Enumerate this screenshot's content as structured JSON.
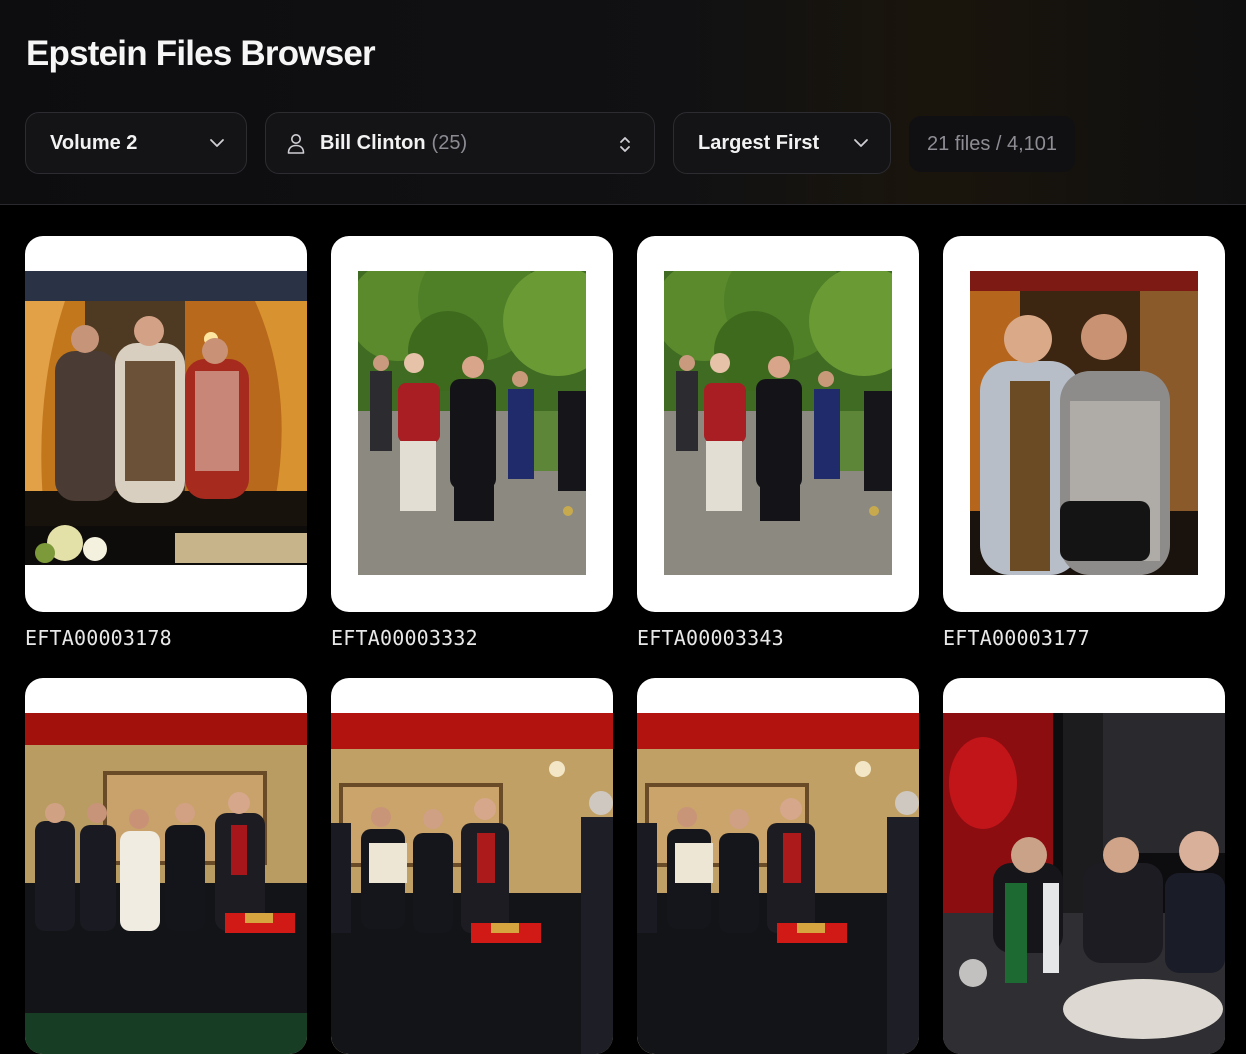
{
  "app": {
    "title": "Epstein Files Browser"
  },
  "filters": {
    "volume": {
      "label": "Volume 2"
    },
    "person": {
      "name": "Bill Clinton",
      "count": "(25)"
    },
    "sort": {
      "label": "Largest First"
    },
    "stats": "21 files / 4,101"
  },
  "files": [
    {
      "id": "EFTA00003178",
      "scene": "party-curtains"
    },
    {
      "id": "EFTA00003332",
      "scene": "park-walk"
    },
    {
      "id": "EFTA00003343",
      "scene": "park-walk"
    },
    {
      "id": "EFTA00003177",
      "scene": "party-two"
    },
    {
      "id": "",
      "scene": "meeting-room"
    },
    {
      "id": "",
      "scene": "meeting-room"
    },
    {
      "id": "",
      "scene": "meeting-room"
    },
    {
      "id": "",
      "scene": "dinner"
    }
  ]
}
